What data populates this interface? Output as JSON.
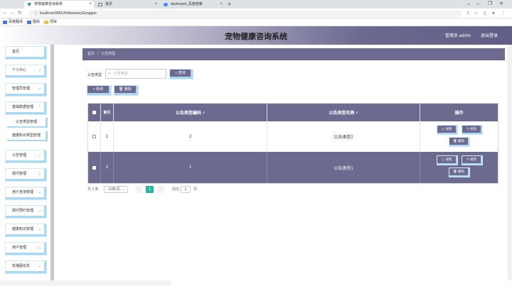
{
  "browser": {
    "tabs": [
      {
        "title": "宠物健康咨询系统",
        "active": true
      },
      {
        "title": "首页",
        "active": false
      },
      {
        "title": "destroyed_百度搜索",
        "active": false
      }
    ],
    "url": "localhost:8081/#/dictionaryGonggao",
    "bookmarks": [
      "百度翻译",
      "图标",
      "项目"
    ]
  },
  "header": {
    "title": "宠物健康咨询系统",
    "user": "管理员 admin",
    "logout": "退出登录"
  },
  "sidebar": {
    "items": [
      {
        "label": "首页",
        "chev": false
      },
      {
        "label": "个人中心",
        "chev": true
      },
      {
        "label": "管理员管理",
        "chev": true
      },
      {
        "label": "基础数据管理",
        "chev": true
      },
      {
        "label": "公告类型管理",
        "sub": true
      },
      {
        "label": "健康知识类型管理",
        "sub": true
      },
      {
        "label": "公告管理",
        "chev": true
      },
      {
        "label": "顾问管理",
        "chev": true
      },
      {
        "label": "用户咨询管理",
        "chev": true
      },
      {
        "label": "顾问预约管理",
        "chev": true
      },
      {
        "label": "健康知识管理",
        "chev": true
      },
      {
        "label": "用户管理",
        "chev": true
      },
      {
        "label": "轮播图信息",
        "chev": true
      }
    ]
  },
  "breadcrumb": {
    "home": "首页",
    "sep": "/",
    "current": "公告类型"
  },
  "search": {
    "label": "公告类型",
    "placeholder": "公告类型",
    "button": "查询"
  },
  "actions": {
    "add": "+ 新增",
    "delete": "删除"
  },
  "table": {
    "headers": {
      "index": "索引",
      "code": "公告类型编码",
      "name": "公告类型名称",
      "ops": "操作"
    },
    "rows": [
      {
        "index": "1",
        "code": "2",
        "name": "公告类型2"
      },
      {
        "index": "2",
        "code": "1",
        "name": "公告类型1"
      }
    ],
    "row_buttons": {
      "detail": "详情",
      "edit": "修改",
      "delete": "删除"
    }
  },
  "pagination": {
    "total": "共 2 条",
    "page_size": "10条/页",
    "current_page": "1",
    "goto_prefix": "前往",
    "goto_value": "1",
    "goto_suffix": "页"
  },
  "colors": {
    "primary": "#6c6a8f",
    "accent_border": "#a9d8f2",
    "pager_active": "#26b5a4"
  }
}
